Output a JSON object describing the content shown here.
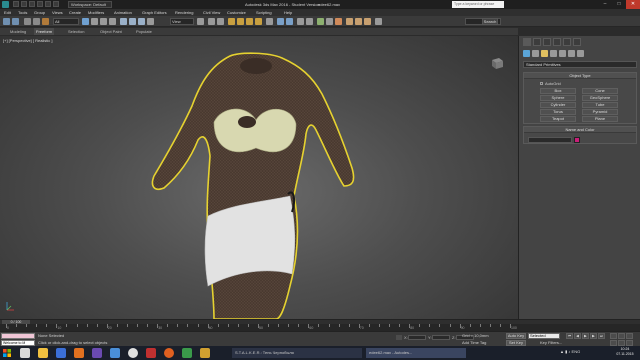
{
  "window": {
    "title": "Autodesk 3ds Max 2016 - Student Version",
    "file": "edee62.max",
    "workspace": "Workspace: Default",
    "search_placeholder": "Type a keyword or phrase",
    "minimize": "–",
    "maximize": "□",
    "close": "✕"
  },
  "menu": [
    "Edit",
    "Tools",
    "Group",
    "Views",
    "Create",
    "Modifiers",
    "Animation",
    "Graph Editors",
    "Rendering",
    "Civil View",
    "Customize",
    "Scripting",
    "Help"
  ],
  "toolbar": {
    "selection_filter": "All",
    "reference_coord": "View",
    "selection_set_button": "Search"
  },
  "ribbon_tabs": [
    "Modeling",
    "Freeform",
    "Selection",
    "Object Paint",
    "Populate"
  ],
  "viewport": {
    "label": "[+] [Perspective] [ Realistic ]"
  },
  "command_panel": {
    "category": "Standard Primitives",
    "object_type_title": "Object Type",
    "autogrid": "AutoGrid",
    "buttons": [
      "Box",
      "Cone",
      "Sphere",
      "GeoSphere",
      "Cylinder",
      "Tube",
      "Torus",
      "Pyramid",
      "Teapot",
      "Plane"
    ],
    "name_color_title": "Name and Color",
    "object_color": "#c81e78"
  },
  "timeline": {
    "slider": "0 / 100",
    "ticks": [
      "0",
      "10",
      "20",
      "30",
      "40",
      "50",
      "60",
      "70",
      "80",
      "90",
      "100"
    ]
  },
  "status": {
    "maxscript_output": "Welcome to M",
    "selection": "None Selected",
    "prompt": "Click or click-and-drag to select objects",
    "x_label": "X:",
    "y_label": "Y:",
    "z_label": "Z:",
    "grid": "Grid = 10,0mm",
    "add_time_tag": "Add Time Tag",
    "auto_key": "Auto Key",
    "set_key": "Set Key",
    "key_filters": "Key Filters...",
    "selected_dropdown": "Selected"
  },
  "taskbar": {
    "items": [
      "S.T.A.L.K.E.R.: Тень Чернобыля",
      "edee62.max - Autodes..."
    ],
    "language": "ENG",
    "time": "10:24",
    "date": "07.11.2015"
  }
}
